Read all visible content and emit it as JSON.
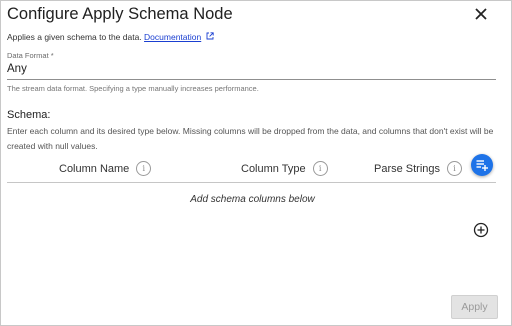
{
  "dialog": {
    "title": "Configure Apply Schema Node",
    "subtitle_text": "Applies a given schema to the data.",
    "doc_link_label": "Documentation"
  },
  "data_format": {
    "label": "Data Format *",
    "value": "Any",
    "helper": "The stream data format. Specifying a type manually increases performance."
  },
  "schema": {
    "label": "Schema:",
    "description": "Enter each column and its desired type below. Missing columns will be dropped from the data, and columns that don't exist will be created with null values.",
    "columns": [
      "Column Name",
      "Column Type",
      "Parse Strings"
    ],
    "empty_message": "Add schema columns below"
  },
  "footer": {
    "apply_label": "Apply"
  },
  "colors": {
    "accent": "#1e73e8",
    "link": "#1a3fd1",
    "disabled_button": "#e3e3e3"
  },
  "icons": {
    "close": "close-icon",
    "external": "external-link-icon",
    "info": "info-icon",
    "add_columns": "playlist-add-icon",
    "add": "plus-circle-icon"
  }
}
